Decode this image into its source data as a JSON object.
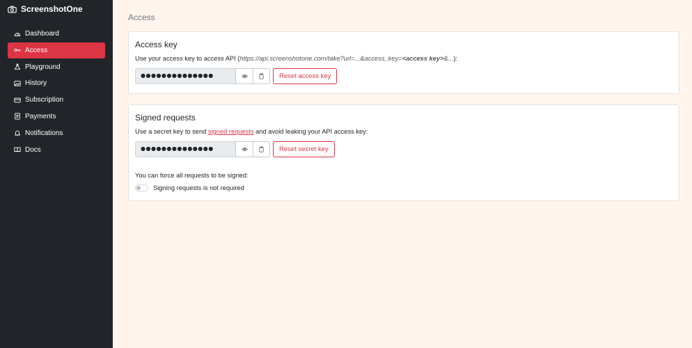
{
  "brand": {
    "name": "ScreenshotOne",
    "icon": "camera-icon"
  },
  "sidebar": {
    "items": [
      {
        "label": "Dashboard",
        "icon": "speedometer-icon",
        "active": false
      },
      {
        "label": "Access",
        "icon": "key-icon",
        "active": true
      },
      {
        "label": "Playground",
        "icon": "playground-icon",
        "active": false
      },
      {
        "label": "History",
        "icon": "image-icon",
        "active": false
      },
      {
        "label": "Subscription",
        "icon": "credit-card-icon",
        "active": false
      },
      {
        "label": "Payments",
        "icon": "receipt-icon",
        "active": false
      },
      {
        "label": "Notifications",
        "icon": "bell-icon",
        "active": false
      },
      {
        "label": "Docs",
        "icon": "book-icon",
        "active": false
      }
    ]
  },
  "page": {
    "title": "Access"
  },
  "access_key": {
    "title": "Access key",
    "desc_prefix": "Use your access key to access API (",
    "desc_url_start": "https://api.screenshotone.com/take?url=...&access_key=",
    "desc_url_key": "<access key>",
    "desc_url_end": "&...",
    "desc_suffix": "):",
    "masked_value": "●●●●●●●●●●●●●●",
    "reset_label": "Reset access key"
  },
  "signed_requests": {
    "title": "Signed requests",
    "desc_prefix": "Use a secret key to send ",
    "desc_link": "signed requests",
    "desc_suffix": " and avoid leaking your API access key:",
    "masked_value": "●●●●●●●●●●●●●●",
    "reset_label": "Reset secret key",
    "force_text": "You can force all requests to be signed:",
    "toggle_label": "Signing requests is not required",
    "toggle_on": false
  },
  "colors": {
    "sidebar_bg": "#212529",
    "accent": "#dc3545",
    "main_bg": "#fff5ec"
  }
}
